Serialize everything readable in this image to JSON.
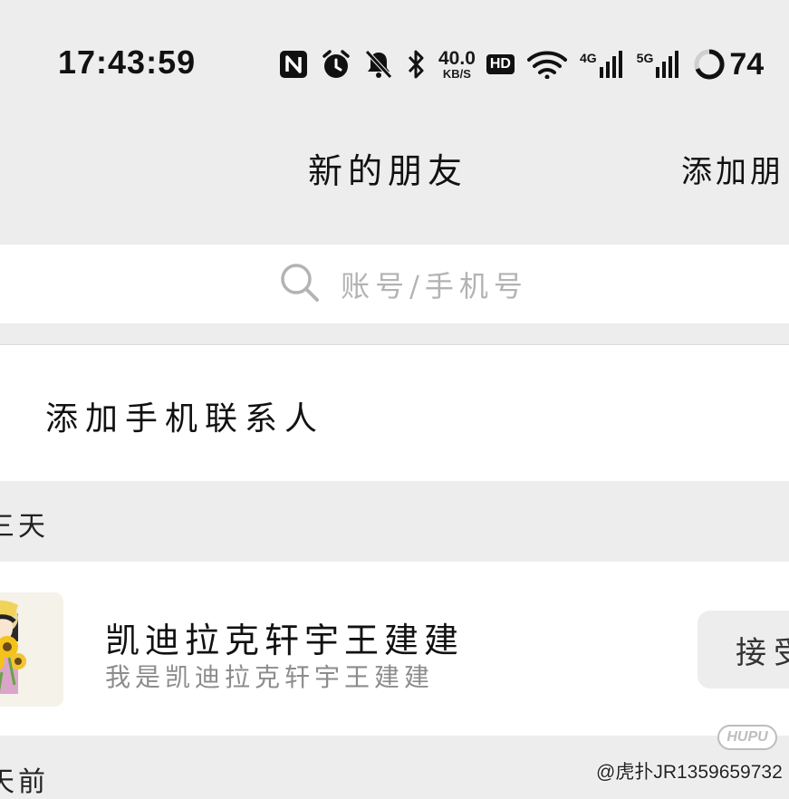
{
  "status_bar": {
    "time": "17:43:59",
    "net_speed_value": "40.0",
    "net_speed_unit": "KB/S",
    "hd_label": "HD",
    "network_4g": "4G",
    "network_5g": "5G",
    "battery": "74",
    "icons": [
      "nfc-icon",
      "alarm-icon",
      "mute-icon",
      "bluetooth-icon",
      "hd-icon",
      "wifi-icon",
      "signal-icon",
      "battery-icon"
    ]
  },
  "header": {
    "tab_new_friends": "新的朋友",
    "tab_add_friends": "添加朋"
  },
  "search": {
    "placeholder": "账号/手机号",
    "icon": "search-icon"
  },
  "add_contacts": {
    "label": "添加手机联系人"
  },
  "sections": [
    {
      "label": "三天"
    },
    {
      "label": "天前"
    }
  ],
  "requests": [
    {
      "name": "凯迪拉克轩宇王建建",
      "message": "我是凯迪拉克轩宇王建建",
      "action_label": "接受",
      "avatar": "sunflower-avatar"
    }
  ],
  "watermark": {
    "text": "@虎扑JR1359659732",
    "logo_text": "HUPU"
  },
  "colors": {
    "background": "#ededed",
    "surface": "#ffffff",
    "placeholder": "#b3b3b3",
    "secondary_text": "#8c8c8c"
  }
}
